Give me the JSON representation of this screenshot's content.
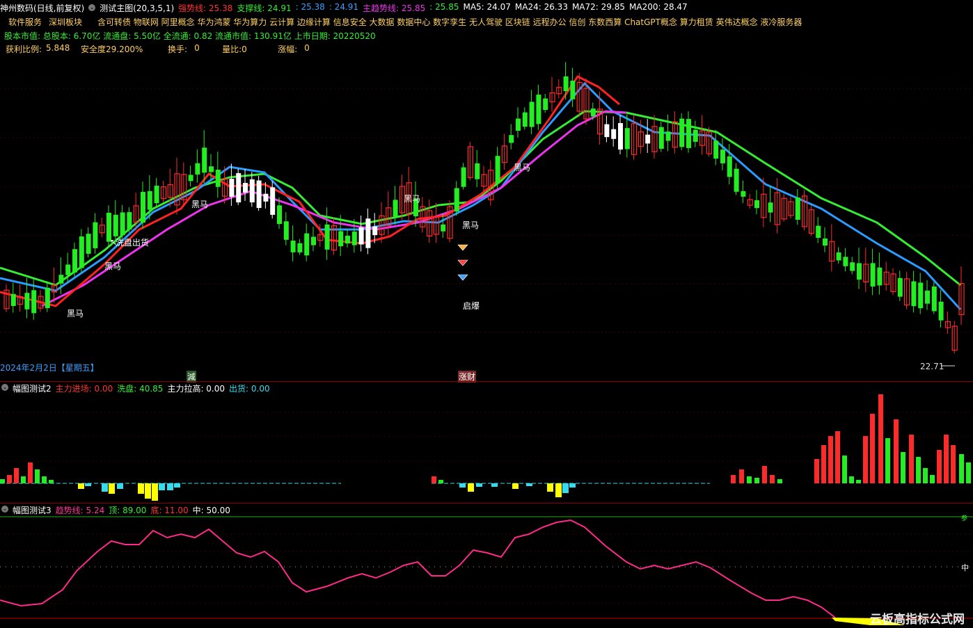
{
  "colors": {
    "red": "#ff2a2a",
    "green": "#22ee22",
    "blue": "#3aa0ff",
    "magenta": "#ff33ff",
    "white": "#ffffff",
    "yellow": "#ffff00",
    "cyan": "#33ddee",
    "gold": "#ffd060",
    "strong_line": "#ff2222",
    "support_line": "#2b9cff",
    "trend_line": "#ee33ee",
    "ma_green": "#33ee33",
    "pink": "#ff2a8a"
  },
  "header": {
    "stock_name": "神州数码(日线,前复权)",
    "indicator_name": "测试主图(20,3,5,1)",
    "items": [
      {
        "label": "强势线:",
        "value": "25.38",
        "color": "#ff3333"
      },
      {
        "label": "支撑线:",
        "value": "24.91",
        "color": "#33ee33"
      },
      {
        "label": ":",
        "value": "25.38",
        "color": "#3aa0ff"
      },
      {
        "label": ":",
        "value": "24.91",
        "color": "#3aa0ff"
      },
      {
        "label": "主趋势线:",
        "value": "25.85",
        "color": "#ee33ee"
      },
      {
        "label": ":",
        "value": "25.85",
        "color": "#33ee33"
      },
      {
        "label": "MA5:",
        "value": "24.07",
        "color": "#ffffff"
      },
      {
        "label": "MA24:",
        "value": "26.33",
        "color": "#ffffff"
      },
      {
        "label": "MA72:",
        "value": "29.85",
        "color": "#ffffff"
      },
      {
        "label": "MA200:",
        "value": "28.47",
        "color": "#ffffff"
      }
    ]
  },
  "info": {
    "sector_label": "软件服务",
    "board_label": "深圳板块",
    "concepts": "含可转债 物联网 阿里概念 华为鸿蒙 华为算力 云计算 边缘计算 信息安全 大数据 数据中心 数字孪生 无人驾驶 区块链 远程办公 信创 东数西算 ChatGPT概念 算力租赁 英伟达概念 液冷服务器",
    "line2": "股本市值: 总股本: 6.70亿 流通盘: 5.50亿 全流通: 0.82 流通市值: 130.91亿 上市日期: 20220520",
    "profit_label": "获利比例:",
    "profit_value": "5.848",
    "safety_label": "安全度29.200%",
    "turnover_label": "换手:",
    "turnover_value": "0",
    "volratio_label": "量比:0",
    "change_label": "涨幅:",
    "change_value": "0"
  },
  "main_chart": {
    "date_label": "2024年2月2日【星期五】",
    "low_price_label": "22.71",
    "bottom_markers": [
      "減",
      "涨财"
    ],
    "annotations": [
      {
        "text": "黑马"
      },
      {
        "text": "黑马"
      },
      {
        "text": "洗盘出货"
      },
      {
        "text": "黑马"
      },
      {
        "text": "黑马"
      },
      {
        "text": "黑马"
      },
      {
        "text": "黑马"
      },
      {
        "text": "启爆"
      }
    ]
  },
  "panel2": {
    "title": "幅图测试2",
    "items": [
      {
        "label": "主力进场:",
        "value": "0.00",
        "color": "#ff3333"
      },
      {
        "label": "洗盘:",
        "value": "40.85",
        "color": "#33ee33"
      },
      {
        "label": "主力拉高:",
        "value": "0.00",
        "color": "#ffffff"
      },
      {
        "label": "出货:",
        "value": "0.00",
        "color": "#33ddee"
      }
    ]
  },
  "panel3": {
    "title": "幅图测试3",
    "items": [
      {
        "label": "趋势线:",
        "value": "5.24",
        "color": "#ff3399"
      },
      {
        "label": "顶:",
        "value": "89.00",
        "color": "#33ee33"
      },
      {
        "label": "底:",
        "value": "11.00",
        "color": "#ff3333"
      },
      {
        "label": "中:",
        "value": "50.00",
        "color": "#ffffff"
      }
    ],
    "right_top_label": "参",
    "right_mid_label": "中",
    "watermark": "云板高指标公式网"
  }
}
